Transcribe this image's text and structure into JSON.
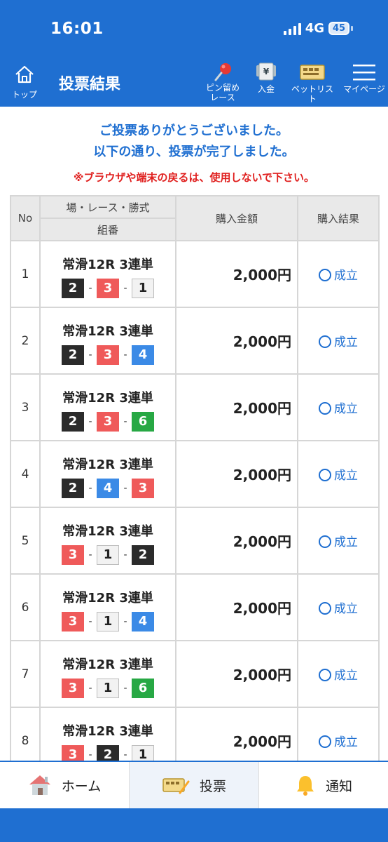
{
  "status_bar": {
    "time": "16:01",
    "network": "4G",
    "battery": "45"
  },
  "header": {
    "home_label": "トップ",
    "title": "投票結果",
    "pin_label_1": "ピン留め",
    "pin_label_2": "レース",
    "deposit_label": "入金",
    "betlist_label": "ベットリスト",
    "mypage_label": "マイページ"
  },
  "messages": {
    "line1": "ご投票ありがとうございました。",
    "line2": "以下の通り、投票が完了しました。",
    "warning": "※ブラウザや端末の戻るは、使用しないで下さい。"
  },
  "table": {
    "headers": {
      "no": "No",
      "race": "場・レース・勝式",
      "combo": "組番",
      "amount": "購入金額",
      "result": "購入結果"
    },
    "rows": [
      {
        "no": "1",
        "race": "常滑12R 3連単",
        "combo": [
          "2",
          "3",
          "1"
        ],
        "amount": "2,000円",
        "result": "成立"
      },
      {
        "no": "2",
        "race": "常滑12R 3連単",
        "combo": [
          "2",
          "3",
          "4"
        ],
        "amount": "2,000円",
        "result": "成立"
      },
      {
        "no": "3",
        "race": "常滑12R 3連単",
        "combo": [
          "2",
          "3",
          "6"
        ],
        "amount": "2,000円",
        "result": "成立"
      },
      {
        "no": "4",
        "race": "常滑12R 3連単",
        "combo": [
          "2",
          "4",
          "3"
        ],
        "amount": "2,000円",
        "result": "成立"
      },
      {
        "no": "5",
        "race": "常滑12R 3連単",
        "combo": [
          "3",
          "1",
          "2"
        ],
        "amount": "2,000円",
        "result": "成立"
      },
      {
        "no": "6",
        "race": "常滑12R 3連単",
        "combo": [
          "3",
          "1",
          "4"
        ],
        "amount": "2,000円",
        "result": "成立"
      },
      {
        "no": "7",
        "race": "常滑12R 3連単",
        "combo": [
          "3",
          "1",
          "6"
        ],
        "amount": "2,000円",
        "result": "成立"
      },
      {
        "no": "8",
        "race": "常滑12R 3連単",
        "combo": [
          "3",
          "2",
          "1"
        ],
        "amount": "2,000円",
        "result": "成立"
      }
    ],
    "combo_separator": "-"
  },
  "boat_colors": {
    "1": {
      "bg": "#f2f2f2",
      "fg": "#222222",
      "border": "#bdbdbd"
    },
    "2": {
      "bg": "#2b2b2b",
      "fg": "#ffffff",
      "border": "#2b2b2b"
    },
    "3": {
      "bg": "#ef5a5a",
      "fg": "#ffffff",
      "border": "#ef5a5a"
    },
    "4": {
      "bg": "#3b8ae6",
      "fg": "#ffffff",
      "border": "#3b8ae6"
    },
    "5": {
      "bg": "#f3d234",
      "fg": "#222222",
      "border": "#f3d234"
    },
    "6": {
      "bg": "#27a844",
      "fg": "#ffffff",
      "border": "#27a844"
    }
  },
  "tabbar": {
    "home_label": "ホーム",
    "vote_label": "投票",
    "notify_label": "通知"
  },
  "colors": {
    "brand": "#1f6fd1",
    "warning": "#e0201f"
  }
}
